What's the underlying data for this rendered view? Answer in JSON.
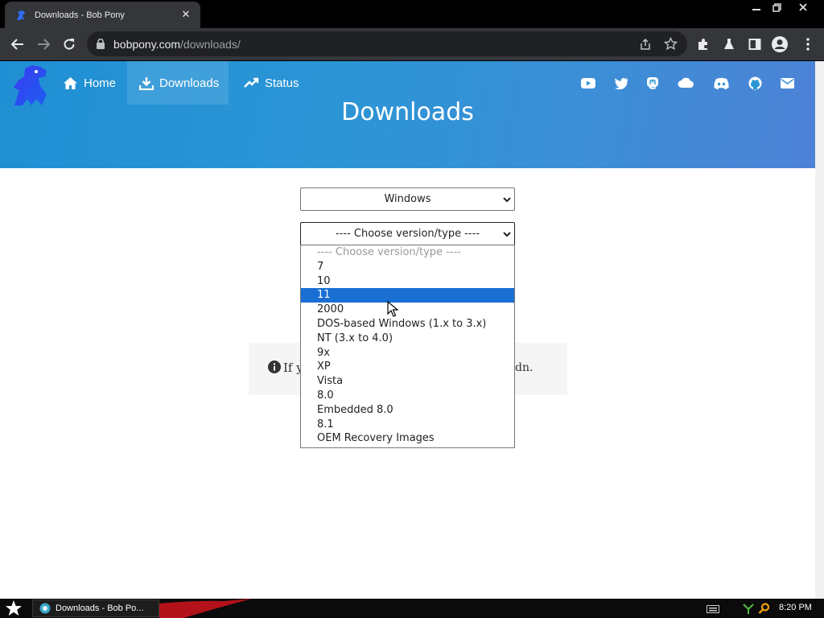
{
  "browser": {
    "tab_title": "Downloads - Bob Pony",
    "url_host": "bobpony.com",
    "url_path": "/downloads/"
  },
  "site": {
    "nav": [
      {
        "label": "Home",
        "icon": "home-icon"
      },
      {
        "label": "Downloads",
        "icon": "download-icon"
      },
      {
        "label": "Status",
        "icon": "chart-icon"
      }
    ],
    "social_icons": [
      "youtube-icon",
      "twitter-icon",
      "mastodon-icon",
      "cloud-icon",
      "discord-icon",
      "github-icon",
      "mail-icon"
    ],
    "hero_title": "Downloads",
    "colors": {
      "hero_start": "#1f8fd3",
      "hero_end": "#4d82d6",
      "selected_option": "#1a6fd3"
    }
  },
  "form": {
    "os_select_value": "Windows",
    "version_select_value": "---- Choose version/type ----",
    "options": [
      "---- Choose version/type ----",
      "7",
      "10",
      "11",
      "2000",
      "DOS-based Windows (1.x to 3.x)",
      "NT (3.x to 4.0)",
      "9x",
      "XP",
      "Vista",
      "8.0",
      "Embedded 8.0",
      "8.1",
      "OEM Recovery Images"
    ],
    "highlighted_option": "11"
  },
  "notice": {
    "text_visible_left": "If y",
    "text_visible_right": "dn."
  },
  "taskbar": {
    "task_label": "Downloads - Bob Po...",
    "clock": "8:20 PM"
  }
}
